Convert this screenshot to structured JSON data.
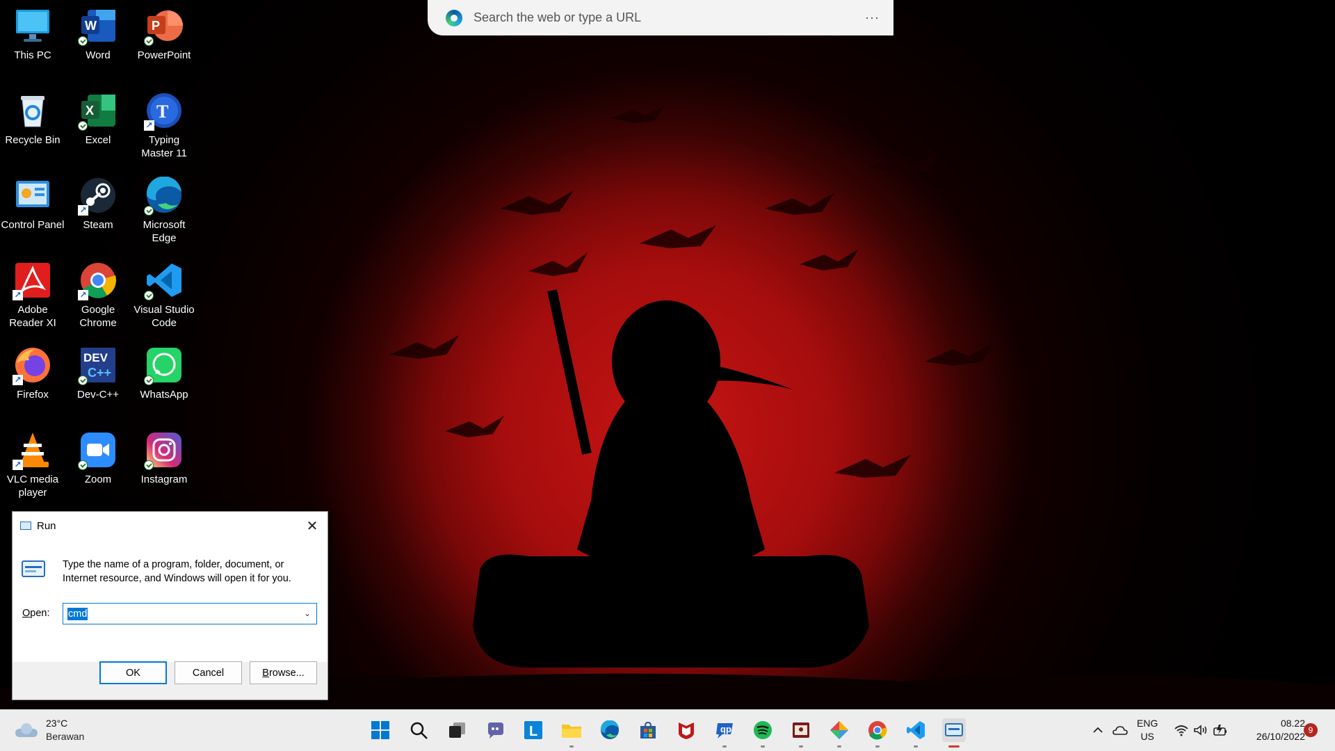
{
  "browser_bar": {
    "placeholder": "Search the web or type a URL",
    "menu_label": "···"
  },
  "desktop_icons": [
    {
      "label": "This PC",
      "icon": "computer-icon"
    },
    {
      "label": "Word",
      "icon": "word-icon"
    },
    {
      "label": "PowerPoint",
      "icon": "powerpoint-icon"
    },
    {
      "label": "Recycle Bin",
      "icon": "recycle-bin-icon"
    },
    {
      "label": "Excel",
      "icon": "excel-icon"
    },
    {
      "label": "Typing Master 11",
      "icon": "typing-master-icon"
    },
    {
      "label": "Control Panel",
      "icon": "control-panel-icon"
    },
    {
      "label": "Steam",
      "icon": "steam-icon"
    },
    {
      "label": "Microsoft Edge",
      "icon": "edge-icon"
    },
    {
      "label": "Adobe Reader XI",
      "icon": "adobe-reader-icon"
    },
    {
      "label": "Google Chrome",
      "icon": "chrome-icon"
    },
    {
      "label": "Visual Studio Code",
      "icon": "vscode-icon"
    },
    {
      "label": "Firefox",
      "icon": "firefox-icon"
    },
    {
      "label": "Dev-C++",
      "icon": "devcpp-icon"
    },
    {
      "label": "WhatsApp",
      "icon": "whatsapp-icon"
    },
    {
      "label": "VLC media player",
      "icon": "vlc-icon"
    },
    {
      "label": "Zoom",
      "icon": "zoom-icon"
    },
    {
      "label": "Instagram",
      "icon": "instagram-icon"
    }
  ],
  "run_dialog": {
    "title": "Run",
    "description": "Type the name of a program, folder, document, or Internet resource, and Windows will open it for you.",
    "open_label_prefix": "O",
    "open_label_rest": "pen:",
    "input_value": "cmd",
    "ok_label": "OK",
    "cancel_label": "Cancel",
    "browse_label_prefix": "B",
    "browse_label_rest": "rowse...",
    "close_glyph": "✕"
  },
  "taskbar": {
    "weather": {
      "temperature": "23°C",
      "condition": "Berawan",
      "icon": "cloud-icon"
    },
    "apps": [
      {
        "name": "start",
        "icon": "windows-start-icon",
        "running": false
      },
      {
        "name": "search",
        "icon": "search-icon",
        "running": false
      },
      {
        "name": "task-view",
        "icon": "task-view-icon",
        "running": false
      },
      {
        "name": "chat",
        "icon": "teams-chat-icon",
        "running": false
      },
      {
        "name": "typing-master",
        "icon": "typing-master-icon",
        "running": false
      },
      {
        "name": "file-explorer",
        "icon": "folder-icon",
        "running": true
      },
      {
        "name": "edge",
        "icon": "edge-icon",
        "running": false
      },
      {
        "name": "store",
        "icon": "store-icon",
        "running": false
      },
      {
        "name": "mcafee",
        "icon": "mcafee-icon",
        "running": false
      },
      {
        "name": "remote-app",
        "icon": "chat-bubble-icon",
        "running": true
      },
      {
        "name": "spotify",
        "icon": "spotify-icon",
        "running": true
      },
      {
        "name": "snipping",
        "icon": "photo-icon",
        "running": true
      },
      {
        "name": "tools",
        "icon": "diamond-tools-icon",
        "running": true
      },
      {
        "name": "chrome",
        "icon": "chrome-icon",
        "running": true
      },
      {
        "name": "vscode",
        "icon": "vscode-icon",
        "running": true
      },
      {
        "name": "run",
        "icon": "run-icon",
        "running": true,
        "active": true
      }
    ],
    "tray": {
      "language_line1": "ENG",
      "language_line2": "US",
      "time": "08.22",
      "date": "26/10/2022",
      "notification_count": "9"
    }
  },
  "colors": {
    "accent": "#0078d7",
    "taskbar_bg": "#ededed",
    "moon_red": "#c81414"
  }
}
